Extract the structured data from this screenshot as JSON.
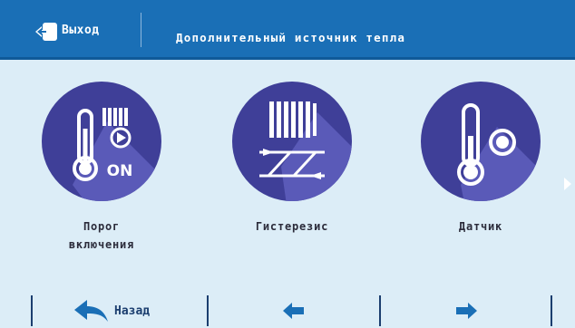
{
  "header": {
    "exit_label": "Выход",
    "title": "Дополнительный источник тепла"
  },
  "tiles": [
    {
      "label": "Порог",
      "label2": "включения",
      "icon": "thermometer-radiator-play-on-icon"
    },
    {
      "label": "Гистерезис",
      "icon": "radiator-hysteresis-icon"
    },
    {
      "label": "Датчик",
      "icon": "thermometer-sensor-icon"
    }
  ],
  "tile_on_text": "ON",
  "footer": {
    "back_label": "Назад"
  },
  "colors": {
    "header_bg": "#1a6fb6",
    "page_bg": "#dcedf7",
    "circle": "#3f3f98",
    "circle_shadow": "#5a5ab8",
    "arrow": "#1a6fb6"
  }
}
